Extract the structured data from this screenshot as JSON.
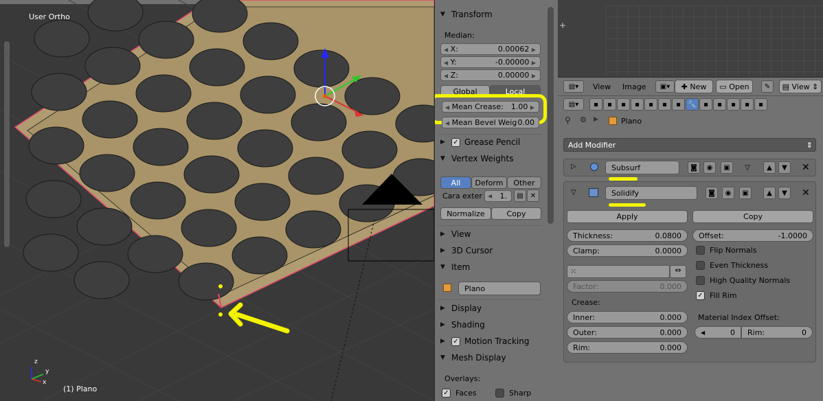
{
  "viewport": {
    "view_label": "User Ortho",
    "object_label": "(1) Plano",
    "axis_x": "x",
    "axis_y": "y",
    "axis_z": "z"
  },
  "npanel": {
    "transform": {
      "title": "Transform",
      "median_label": "Median:",
      "x_label": "X:",
      "x_value": "0.00062",
      "y_label": "Y:",
      "y_value": "-0.00000",
      "z_label": "Z:",
      "z_value": "0.00000",
      "global_label": "Global",
      "local_label": "Local",
      "mean_crease_label": "Mean Crease:",
      "mean_crease_value": "1.00",
      "mean_bevel_label": "Mean Bevel Weig",
      "mean_bevel_value": "0.00"
    },
    "grease_pencil": {
      "title": "Grease Pencil",
      "checked": true
    },
    "vertex_weights": {
      "title": "Vertex Weights",
      "tabs": [
        "All",
        "Deform",
        "Other"
      ],
      "group_name": "Cara exter",
      "group_value": "1.",
      "normalize_label": "Normalize",
      "copy_label": "Copy"
    },
    "view_title": "View",
    "cursor_title": "3D Cursor",
    "item": {
      "title": "Item",
      "name": "Plano"
    },
    "display_title": "Display",
    "shading_title": "Shading",
    "motion_tracking": {
      "title": "Motion Tracking",
      "checked": true
    },
    "mesh_display": {
      "title": "Mesh Display",
      "overlays_label": "Overlays:",
      "faces_label": "Faces",
      "sharp_label": "Sharp"
    }
  },
  "image_editor_header": {
    "view_menu": "View",
    "image_menu": "Image",
    "new_label": "New",
    "open_label": "Open",
    "view_dropdown": "View"
  },
  "properties": {
    "breadcrumb_object": "Plano",
    "add_modifier_label": "Add Modifier",
    "subsurf": {
      "name": "Subsurf"
    },
    "solidify": {
      "name": "Solidify",
      "apply_label": "Apply",
      "copy_label": "Copy",
      "thickness_label": "Thickness:",
      "thickness_value": "0.0800",
      "offset_label": "Offset:",
      "offset_value": "-1.0000",
      "clamp_label": "Clamp:",
      "clamp_value": "0.0000",
      "flip_normals_label": "Flip Normals",
      "even_thickness_label": "Even Thickness",
      "high_quality_label": "High Quality Normals",
      "fill_rim_label": "Fill Rim",
      "factor_label": "Factor:",
      "factor_value": "0.000",
      "crease_label": "Crease:",
      "inner_label": "Inner:",
      "inner_value": "0.000",
      "outer_label": "Outer:",
      "outer_value": "0.000",
      "rim_label": "Rim:",
      "rim_value": "0.000",
      "material_offset_label": "Material Index Offset:",
      "material_value": "0",
      "material_rim_label": "Rim:",
      "material_rim_value": "0"
    }
  },
  "colors": {
    "highlight": "#f3f300",
    "selected_blue": "#5680c2",
    "mesh_fill": "#b09c70"
  }
}
